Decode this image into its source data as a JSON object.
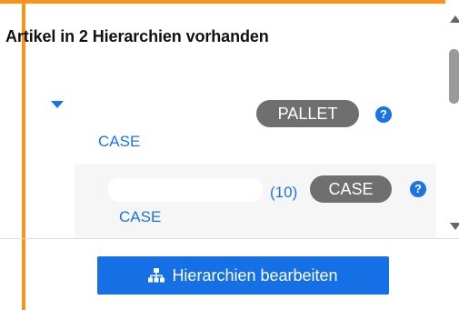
{
  "title": "Artikel in 2 Hierarchien vorhanden",
  "tree": {
    "parent": {
      "badge": "PALLET",
      "help_glyph": "?",
      "link": "CASE"
    },
    "child": {
      "count": "(10)",
      "badge": "CASE",
      "help_glyph": "?",
      "link": "CASE"
    }
  },
  "button": {
    "label": "Hierarchien bearbeiten",
    "icon": "sitemap-icon"
  },
  "colors": {
    "accent": "#1a73e8",
    "badge": "#6f6f6f",
    "frame": "#f7941d"
  }
}
